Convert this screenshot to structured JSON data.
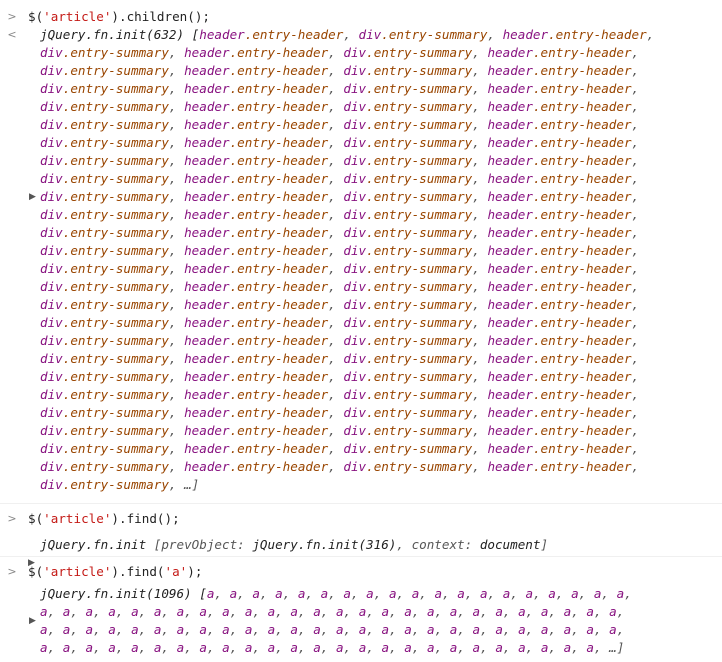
{
  "console": {
    "colors": {
      "tag": "#881280",
      "class": "#994500",
      "string": "#c41a16",
      "key": "#565656"
    },
    "icons": {
      "input_prompt": "chevron-right-icon",
      "result_prompt": "return-arrow-icon",
      "expand": "expand-triangle-icon"
    },
    "entry1": {
      "prompt": ">",
      "input": {
        "pre": "$(",
        "arg": "'article'",
        "post": ").children();"
      },
      "result_prompt": "<",
      "head": "jQuery.fn.init(632) [",
      "head_tokens": [
        {
          "tag": "header",
          "cls": "entry-header"
        },
        {
          "tag": "div",
          "cls": "entry-summary"
        },
        {
          "tag": "header",
          "cls": "entry-header"
        }
      ],
      "row_tokens": [
        {
          "tag": "div",
          "cls": "entry-summary"
        },
        {
          "tag": "header",
          "cls": "entry-header"
        },
        {
          "tag": "div",
          "cls": "entry-summary"
        },
        {
          "tag": "header",
          "cls": "entry-header"
        }
      ],
      "row_count": 24,
      "last_token": {
        "tag": "div",
        "cls": "entry-summary"
      },
      "ellipsis": "…]"
    },
    "entry2": {
      "prompt": ">",
      "input": {
        "pre": "$(",
        "arg": "'article'",
        "post": ").find();"
      },
      "result": {
        "name": "jQuery.fn.init ",
        "open": "[",
        "key1": "prevObject",
        "val1": "jQuery.fn.init(316)",
        "key2": "context",
        "val2": "document",
        "close": "]"
      }
    },
    "entry3": {
      "prompt": ">",
      "input": {
        "pre": "$(",
        "arg": "'a'",
        "post": ");"
      },
      "input_prefix": "$('article').find(",
      "head": "jQuery.fn.init(1096) [",
      "item": "a",
      "first_row_count": 19,
      "row_count": 26,
      "last_row_count": 25,
      "ellipsis": "…]"
    }
  }
}
